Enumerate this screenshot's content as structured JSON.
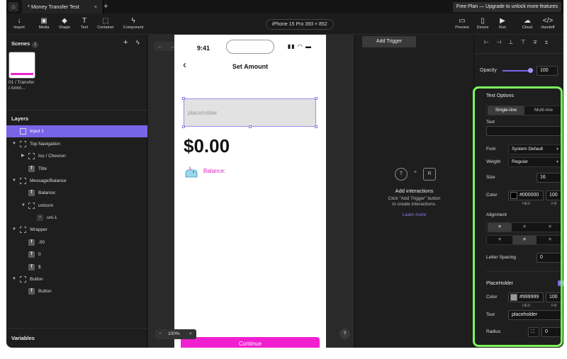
{
  "titlebar": {
    "tab_title": "* Money Transfer Test",
    "tab_close": "×",
    "new_tab": "+",
    "plan_banner": "Free Plan — Upgrade to unlock more features"
  },
  "toolbar": {
    "tools": [
      {
        "label": "Import",
        "icon": "import-icon"
      },
      {
        "label": "Media",
        "icon": "media-icon"
      },
      {
        "label": "Shape",
        "icon": "shape-icon"
      },
      {
        "label": "Text",
        "icon": "text-icon"
      },
      {
        "label": "Container",
        "icon": "container-icon"
      },
      {
        "label": "Component",
        "icon": "component-icon"
      }
    ],
    "device": "iPhone 15 Pro  393 × 852",
    "right_tools": [
      {
        "label": "Preview",
        "icon": "preview-icon"
      },
      {
        "label": "Device",
        "icon": "device-icon"
      },
      {
        "label": "Run",
        "icon": "run-icon"
      },
      {
        "label": "Cloud",
        "icon": "cloud-icon"
      },
      {
        "label": "Handoff",
        "icon": "handoff-icon"
      }
    ]
  },
  "scenes": {
    "title": "Scenes",
    "count": "1",
    "items": [
      {
        "label": "01 / Transfer / Amm..."
      }
    ]
  },
  "layers": {
    "title": "Layers",
    "items": [
      {
        "name": "Input 1",
        "selected": true,
        "type": "input"
      },
      {
        "name": "Top Navigation",
        "type": "frame"
      },
      {
        "name": "Ico / Chevron",
        "type": "frame"
      },
      {
        "name": "Title",
        "type": "text"
      },
      {
        "name": "Message/Balance",
        "type": "frame"
      },
      {
        "name": "Balance:",
        "type": "text"
      },
      {
        "name": "unicorn",
        "type": "frame"
      },
      {
        "name": "uni-1",
        "type": "image"
      },
      {
        "name": "Wrapper",
        "type": "frame"
      },
      {
        "name": ".00",
        "type": "text"
      },
      {
        "name": "0",
        "type": "text"
      },
      {
        "name": "$",
        "type": "text"
      },
      {
        "name": "Button",
        "type": "frame"
      },
      {
        "name": "Button",
        "type": "text"
      }
    ]
  },
  "variables": {
    "title": "Variables"
  },
  "canvas": {
    "zoom": "100%",
    "zoom_minus": "−",
    "zoom_plus": "+",
    "help": "?"
  },
  "phone": {
    "time": "9:41",
    "title": "Set Amount",
    "input_placeholder": "placeholder",
    "amount": "$0.00",
    "balance_label": "Balance:",
    "continue_label": "Continue"
  },
  "interactions": {
    "add_trigger": "Add Trigger",
    "icon_t": "T",
    "icon_r": "R",
    "plus": "+",
    "title": "Add interactions",
    "desc_line1": "Click \"Add Trigger\" button",
    "desc_line2": "to create interactions.",
    "link": "Learn more"
  },
  "properties": {
    "opacity_label": "Opacity",
    "opacity_value": "100",
    "text_options": {
      "title": "Text Options",
      "mode_single": "Single-line",
      "mode_multi": "Multi-line",
      "text_label": "Text",
      "text_value": "",
      "font_label": "Font",
      "font_value": "System Default",
      "weight_label": "Weight",
      "weight_value": "Regular",
      "size_label": "Size",
      "size_value": "16",
      "color_label": "Color",
      "color_hex": "#000000",
      "color_fill": "100",
      "hex_sub": "HEX",
      "fill_sub": "Fill",
      "alignment_label": "Alignment",
      "letter_spacing_label": "Letter Spacing",
      "letter_spacing_value": "0"
    },
    "placeholder": {
      "title": "PlaceHolder",
      "enabled": true,
      "color_label": "Color",
      "color_hex": "#999999",
      "color_fill": "100",
      "hex_sub": "HEX",
      "fill_sub": "Fill",
      "text_label": "Text",
      "text_value": "placeholder",
      "radius_label": "Radius",
      "radius_value": "0"
    },
    "accent_color": "#7864e6",
    "highlight_color": "#7cfa5a"
  }
}
